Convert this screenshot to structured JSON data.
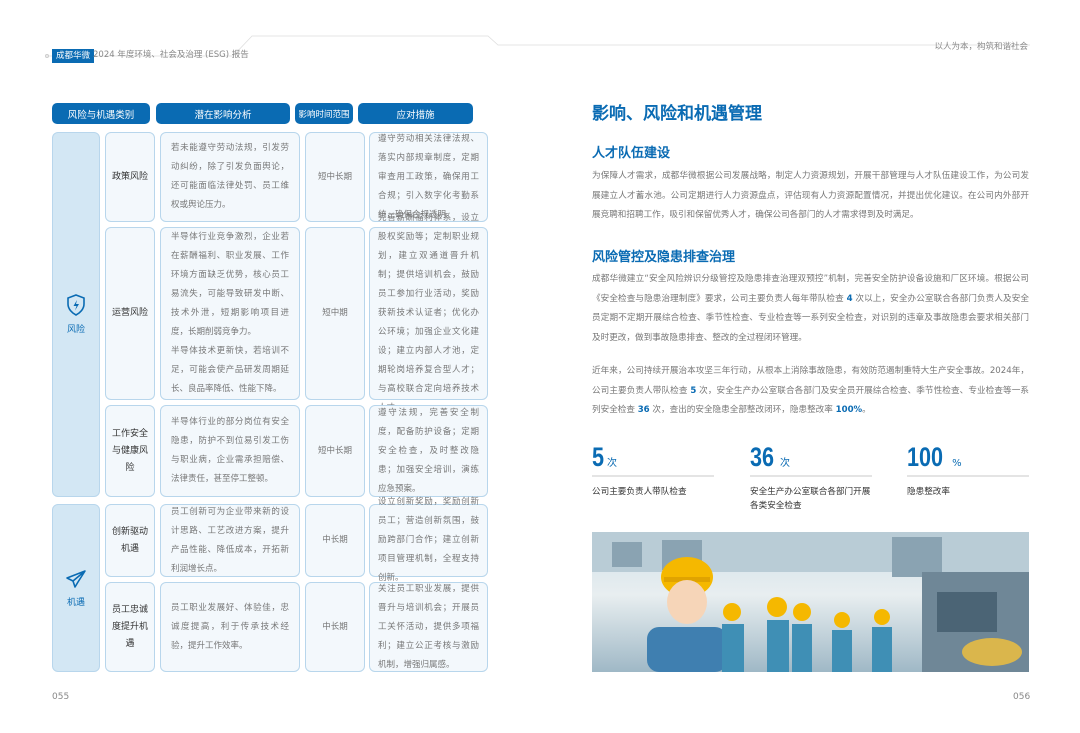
{
  "header": {
    "company_tag": "成都华微",
    "report_title": "2024 年度环境、社会及治理 (ESG) 报告",
    "slogan": "以人为本，构筑和谐社会"
  },
  "table": {
    "headers": [
      "风险与机遇类别",
      "潜在影响分析",
      "影响时间范围",
      "应对措施"
    ],
    "groups": [
      {
        "label": "风险",
        "icon": "shield-lightning-icon",
        "rows": [
          {
            "type": "政策风险",
            "impact": "若未能遵守劳动法规，引发劳动纠纷，除了引发负面舆论，还可能面临法律处罚、员工维权或舆论压力。",
            "time": "短中长期",
            "measures": "遵守劳动相关法律法规、落实内部规章制度，定期审查用工政策，确保用工合规；引入数字化考勤系统，确保合规透明。"
          },
          {
            "type": "运营风险",
            "impact": "半导体行业竞争激烈，企业若在薪酬福利、职业发展、工作环境方面缺乏优势，核心员工易流失，可能导致研发中断、技术外泄，短期影响项目进度，长期削弱竞争力。",
            "impact2": "半导体技术更新快，若培训不足，可能会使产品研发周期延长、良品率降低、性能下降。",
            "time": "短中期",
            "measures": "完善薪酬福利体系，设立股权奖励等；定制职业规划，建立双通道晋升机制；提供培训机会，鼓励员工参加行业活动，奖励获新技术认证者；优化办公环境；加强企业文化建设；建立内部人才池，定期轮岗培养复合型人才；与高校联合定向培养技术人才。"
          },
          {
            "type": "工作安全与健康风险",
            "impact": "半导体行业的部分岗位有安全隐患，防护不到位易引发工伤与职业病，企业需承担赔偿、法律责任，甚至停工整顿。",
            "time": "短中长期",
            "measures": "遵守法规，完善安全制度，配备防护设备；定期安全检查，及时整改隐患；加强安全培训，演练应急预案。"
          }
        ]
      },
      {
        "label": "机遇",
        "icon": "paper-plane-icon",
        "rows": [
          {
            "type": "创新驱动机遇",
            "impact": "员工创新可为企业带来新的设计思路、工艺改进方案，提升产品性能、降低成本，开拓新利润增长点。",
            "time": "中长期",
            "measures": "设立创新奖励，奖励创新员工；营造创新氛围，鼓励跨部门合作；建立创新项目管理机制，全程支持创新。"
          },
          {
            "type": "员工忠诚度提升机遇",
            "impact": "员工职业发展好、体验佳，忠诚度提高，利于传承技术经验，提升工作效率。",
            "time": "中长期",
            "measures": "关注员工职业发展，提供晋升与培训机会；开展员工关怀活动，提供多项福利；建立公正考核与激励机制，增强归属感。"
          }
        ]
      }
    ]
  },
  "right": {
    "title": "影响、风险和机遇管理",
    "s1_title": "人才队伍建设",
    "s1_text": "为保障人才需求，成都华微根据公司发展战略，制定人力资源规划，开展干部管理与人才队伍建设工作，为公司发展建立人才蓄水池。公司定期进行人力资源盘点，评估现有人力资源配置情况，并提出优化建议。在公司内外部开展竞聘和招聘工作，吸引和保留优秀人才，确保公司各部门的人才需求得到及时满足。",
    "s2_title": "风险管控及隐患排查治理",
    "s2_p1a": "成都华微建立“安全风险辨识分级管控及隐患排查治理双预控”机制，完善安全防护设备设施和厂区环境。根据公司《安全检查与隐患治理制度》要求，公司主要负责人每年带队检查 ",
    "s2_p1_num": "4",
    "s2_p1b": " 次以上，安全办公室联合各部门负责人及安全员定期不定期开展综合检查、季节性检查、专业检查等一系列安全检查，对识别的违章及事故隐患会要求相关部门及时更改，做到事故隐患排查、整改的全过程闭环管理。",
    "s2_p2a": "近年来，公司持续开展治本攻坚三年行动，从根本上消除事故隐患，有效防范遏制重特大生产安全事故。2024年，公司主要负责人带队检查 ",
    "s2_p2_n1": "5",
    "s2_p2b": " 次，安全生产办公室联合各部门及安全员开展综合检查、季节性检查、专业检查等一系列安全检查 ",
    "s2_p2_n2": "36",
    "s2_p2c": " 次，查出的安全隐患全部整改闭环，隐患整改率 ",
    "s2_p2_n3": "100%",
    "s2_p2d": "。",
    "stats": [
      {
        "value": "5",
        "unit": "次",
        "label": "公司主要负责人带队检查"
      },
      {
        "value": "36",
        "unit": "次",
        "label": "安全生产办公室联合各部门开展各类安全检查"
      },
      {
        "value": "100",
        "unit": "%",
        "label": "隐患整改率"
      }
    ]
  },
  "pages": {
    "left": "055",
    "right": "056"
  },
  "colors": {
    "brand": "#0a6bb3",
    "cell_bg": "#f3f8fc",
    "group_bg": "#d3e7f4"
  }
}
